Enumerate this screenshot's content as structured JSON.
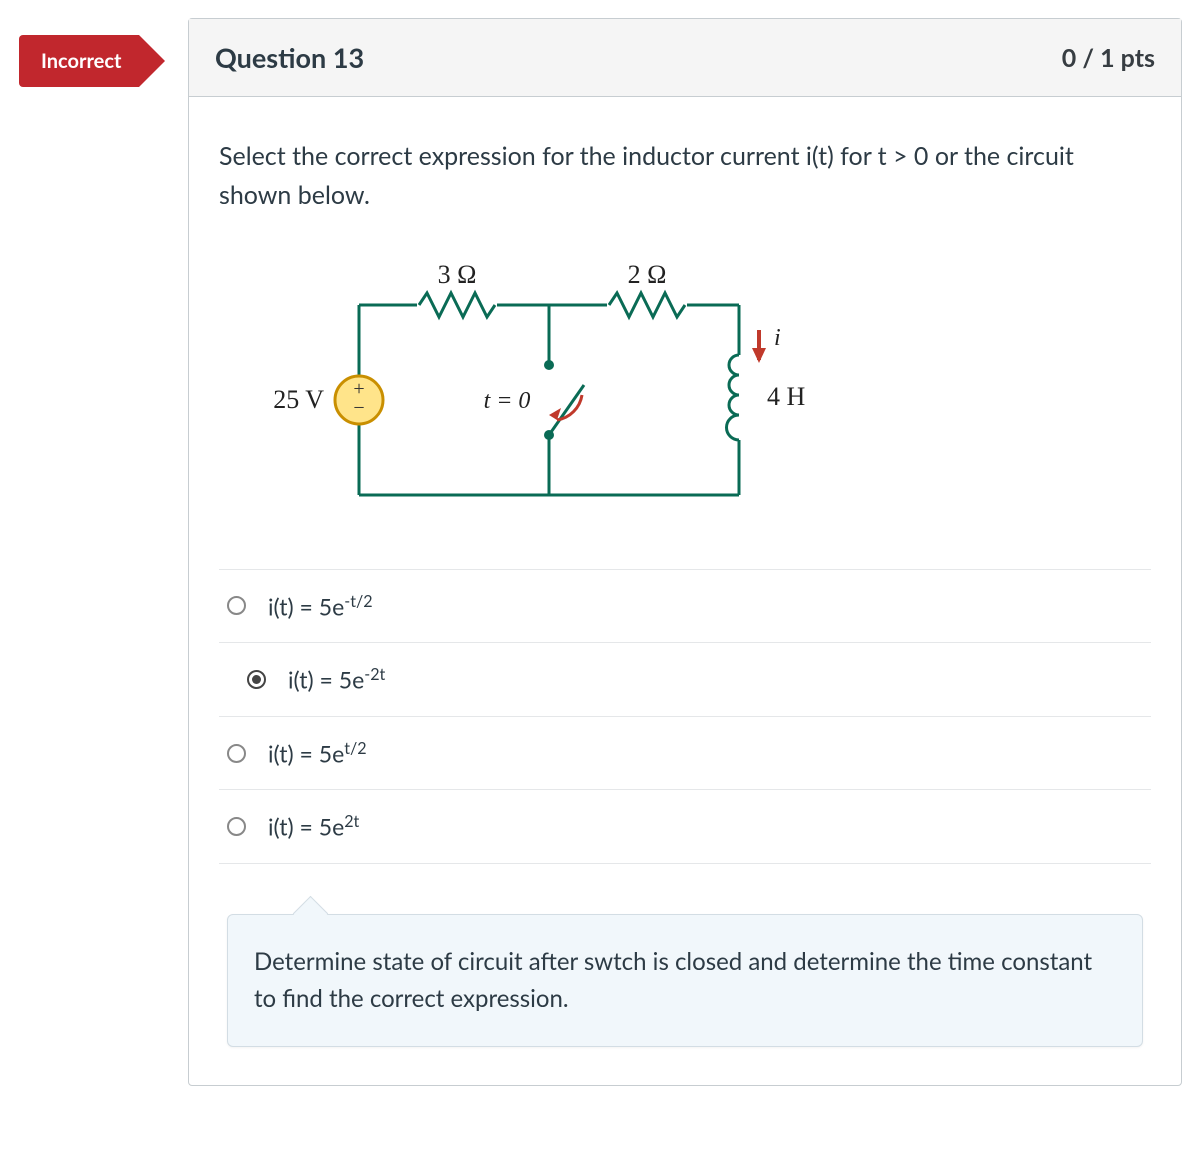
{
  "flag": "Incorrect",
  "header": {
    "title": "Question 13",
    "points": "0 / 1 pts"
  },
  "prompt": "Select the correct expression for the inductor current i(t) for t > 0  or the circuit shown below.",
  "circuit": {
    "source": "25 V",
    "r1": "3 Ω",
    "r2": "2 Ω",
    "switch": "t = 0",
    "i_label": "i",
    "inductor": "4 H"
  },
  "answers": [
    {
      "base": "i(t) = 5e",
      "sup": "-t/2",
      "selected": false
    },
    {
      "base": "i(t) = 5e",
      "sup": "-2t",
      "selected": true
    },
    {
      "base": "i(t) = 5e",
      "sup": "t/2",
      "selected": false
    },
    {
      "base": "i(t) = 5e",
      "sup": "2t",
      "selected": false
    }
  ],
  "feedback": "Determine state of circuit after swtch is closed and determine the time constant to find the correct expression."
}
